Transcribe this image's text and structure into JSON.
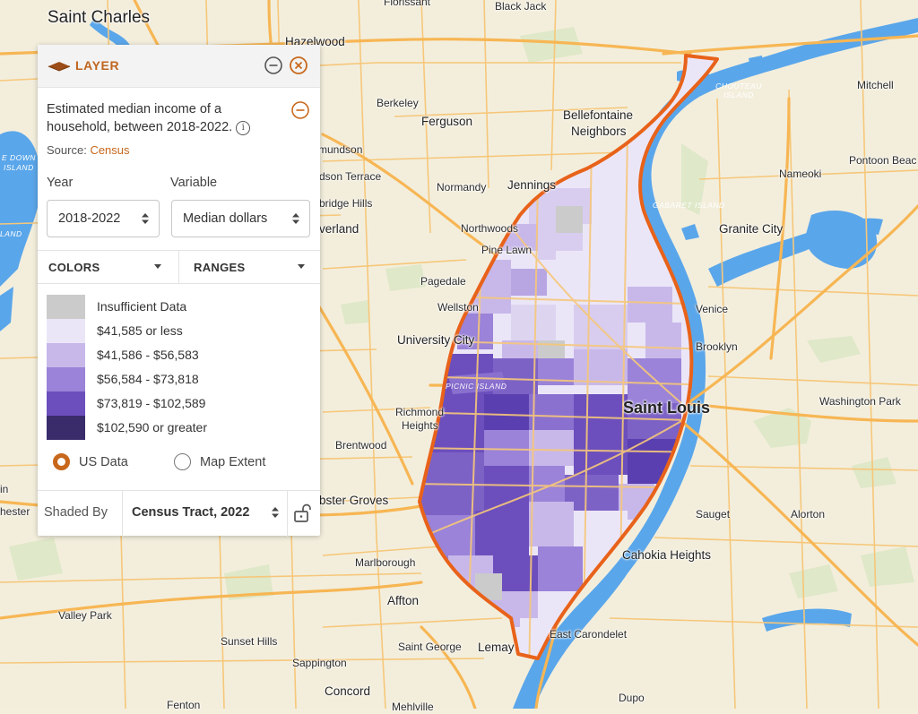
{
  "panel": {
    "title": "LAYER",
    "description": "Estimated median income of a household, between 2018-2022.",
    "source_prefix": "Source:",
    "source_link": "Census",
    "year_label": "Year",
    "year_value": "2018-2022",
    "variable_label": "Variable",
    "variable_value": "Median dollars",
    "colors_tab": "COLORS",
    "ranges_tab": "RANGES",
    "legend": [
      {
        "label": "Insufficient Data",
        "color": "#cbcbcb"
      },
      {
        "label": "$41,585 or less",
        "color": "#ebe6f7"
      },
      {
        "label": "$41,586 - $56,583",
        "color": "#c8b8ea"
      },
      {
        "label": "$56,584 - $73,818",
        "color": "#9a83d8"
      },
      {
        "label": "$73,819 - $102,589",
        "color": "#6c4fbd"
      },
      {
        "label": "$102,590 or greater",
        "color": "#3a2c6b"
      }
    ],
    "radio_us": "US Data",
    "radio_extent": "Map Extent",
    "shaded_by_label": "Shaded By",
    "shaded_by_value": "Census Tract, 2022",
    "accent_color": "#c8681c"
  },
  "map": {
    "labels": {
      "saint_charles": "Saint Charles",
      "florissant": "Florissant",
      "black_jack": "Black Jack",
      "hazelwood": "Hazelwood",
      "berkeley": "Berkeley",
      "ferguson": "Ferguson",
      "bellefontaine": "Bellefontaine",
      "neighbors": "Neighbors",
      "jennings": "Jennings",
      "normandy": "Normandy",
      "northwoods": "Northwoods",
      "pine_lawn": "Pine Lawn",
      "pagedale": "Pagedale",
      "wellston": "Wellston",
      "university_city": "University City",
      "richmond": "Richmond",
      "heights": "Heights",
      "brentwood": "Brentwood",
      "webster_groves": "bster Groves",
      "marlborough": "Marlborough",
      "affton": "Affton",
      "valley_park": "Valley Park",
      "sunset_hills": "Sunset Hills",
      "sappington": "Sappington",
      "saint_george": "Saint George",
      "lemay": "Lemay",
      "concord": "Concord",
      "fenton": "Fenton",
      "mehlville": "Mehlville",
      "east_carondelet": "East Carondelet",
      "dupo": "Dupo",
      "cahokia_heights": "Cahokia Heights",
      "sauget": "Sauget",
      "alorton": "Alorton",
      "saint_louis": "Saint Louis",
      "brooklyn": "Brooklyn",
      "venice": "Venice",
      "granite_city": "Granite City",
      "washington_park": "Washington Park",
      "mitchell": "Mitchell",
      "pontoon_beach": "Pontoon Beac",
      "nameoki": "Nameoki",
      "chouteau_island": "CHOUTEAU ISLAND",
      "gabaret_island": "GABARET ISLAND",
      "picnic_island": "PICNIC ISLAND",
      "mundson": "mundson",
      "bridgeton_terrace": "dson Terrace",
      "bridge_hills": "bridge Hills",
      "overland": "verland",
      "chesterfield_edge": "hester",
      "ellisville_edge": "in",
      "towne_down": "E DOWN",
      "island": "ISLAND",
      "land": "LAND"
    }
  }
}
